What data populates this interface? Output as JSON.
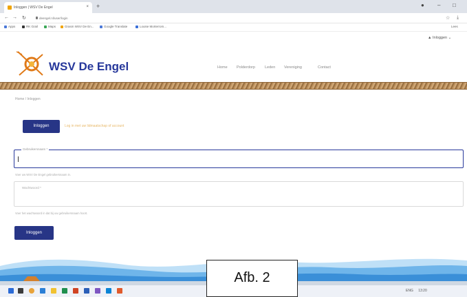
{
  "browser": {
    "tab_title": "Inloggen | WSV De Engel",
    "tab_close": "×",
    "new_tab": "+",
    "url": "deengel.nl/user/login",
    "bookmarks": [
      "Apps",
      "RK Grail",
      "Maps",
      "Grasm WSV De En...",
      "Google Translate",
      "Louise Morterrom..."
    ],
    "right_bookmark": "Lees"
  },
  "site": {
    "user_menu": "Inloggen",
    "brand": "WSV De Engel",
    "menu": [
      "Home",
      "Polderdorp",
      "Leden",
      "Vereniging",
      "Contact"
    ],
    "breadcrumb": "Home / Inloggen"
  },
  "login": {
    "top_button": "Inloggen",
    "notice": "Log in met uw lidmaatschap of account",
    "username_label": "Gebruikersnaam *",
    "username_value": "",
    "username_hint": "Voer uw WSV De Engel gebruikersnaam in.",
    "password_label": "Wachtwoord *",
    "password_value": "",
    "password_hint": "Voer het wachtwoord in dat bij uw gebruikersnaam hoort.",
    "submit_button": "Inloggen"
  },
  "taskbar": {
    "tray_text": "ENG",
    "clock": "13:20"
  },
  "caption": "Afb. 2",
  "colors": {
    "brand_blue": "#27389b",
    "button_blue": "#273586",
    "notice_orange": "#e8b96a",
    "wave_blue": "#3a8fd8"
  }
}
